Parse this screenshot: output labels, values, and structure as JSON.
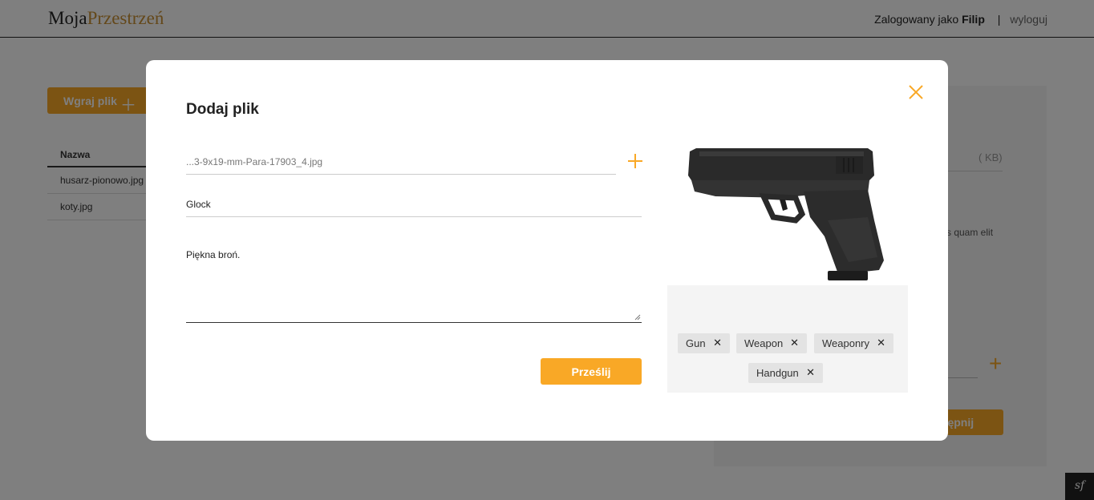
{
  "header": {
    "logo_part1": "Moja",
    "logo_part2": "Przestrzeń",
    "logged_in_prefix": "Zalogowany jako",
    "username": "Filip",
    "separator": "|",
    "logout_label": "wyloguj"
  },
  "background": {
    "upload_button_label": "Wgraj plik",
    "table": {
      "header": "Nazwa",
      "rows": [
        "husarz-pionowo.jpg",
        "koty.jpg"
      ]
    },
    "side_panel": {
      "size_unit": "( KB)",
      "desc_fragment": "llis quam elit",
      "share_button_fragment": "stępnij"
    }
  },
  "modal": {
    "title": "Dodaj plik",
    "file_field_value": "...3-9x19-mm-Para-17903_4.jpg",
    "name_field_value": "Glock",
    "description_value": "Piękna broń.",
    "submit_label": "Prześlij",
    "tags": [
      {
        "label": "Gun"
      },
      {
        "label": "Weapon"
      },
      {
        "label": "Weaponry"
      },
      {
        "label": "Handgun"
      }
    ]
  },
  "colors": {
    "accent": "#f9a826",
    "logo_accent": "#c89034",
    "overlay": "rgba(0,0,0,0.5)"
  }
}
